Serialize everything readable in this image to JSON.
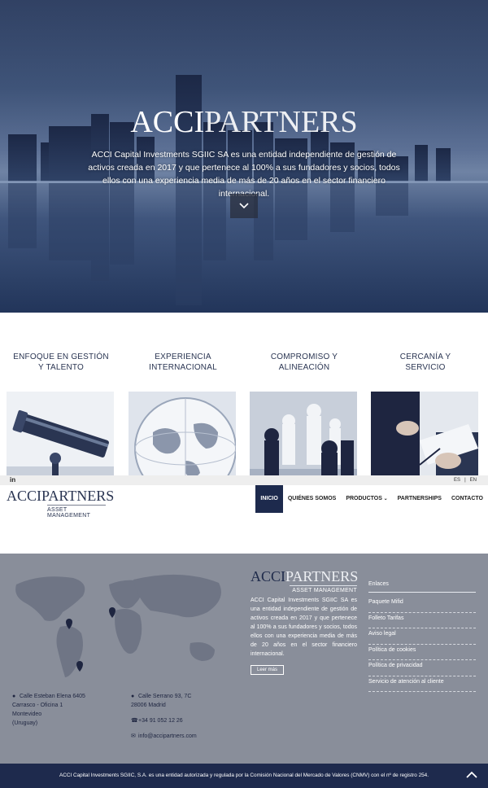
{
  "hero": {
    "logo_bold": "ACCI",
    "logo_light": "PARTNERS",
    "description": "ACCI Capital Investments SGIIC SA es una entidad independiente de gestión de activos creada en 2017 y que pertenece al 100% a sus fundadores y socios, todos ellos con una experiencia media de más de 20 años en el sector financiero internacional.",
    "scroll_icon": "chevron-down-icon"
  },
  "features": [
    {
      "title_line1": "ENFOQUE EN GESTIÓN",
      "title_line2": "Y TALENTO",
      "image": "telescope-image"
    },
    {
      "title_line1": "EXPERIENCIA",
      "title_line2": "INTERNACIONAL",
      "image": "globe-image"
    },
    {
      "title_line1": "COMPROMISO Y",
      "title_line2": "ALINEACIÓN",
      "image": "chess-image"
    },
    {
      "title_line1": "CERCANÍA Y",
      "title_line2": "SERVICIO",
      "image": "handshake-image"
    }
  ],
  "topbar": {
    "linkedin": "in",
    "lang_es": "ES",
    "lang_sep": "|",
    "lang_en": "EN"
  },
  "nav": {
    "logo_bold": "ACCI",
    "logo_light": "PARTNERS",
    "logo_sub": "ASSET MANAGEMENT",
    "items": [
      {
        "label": "INICIO"
      },
      {
        "label": "QUIÉNES SOMOS"
      },
      {
        "label": "PRODUCTOS"
      },
      {
        "label": "PARTNERSHIPS"
      },
      {
        "label": "CONTACTO"
      }
    ]
  },
  "footer": {
    "address1": {
      "line1": "Calle Esteban Elena 6405",
      "line2": "Carrasco - Oficina 1",
      "line3": "Montevideo",
      "line4": "(Uruguay)"
    },
    "address2": {
      "line1": "Calle Serrano 93, 7C",
      "line2": "28006 Madrid"
    },
    "phone": "+34 91 052 12 26",
    "email": "info@accipartners.com",
    "logo_bold": "ACCI",
    "logo_light": "PARTNERS",
    "logo_sub": "ASSET MANAGEMENT",
    "description": "ACCI Capital Investments SGIIC SA es una entidad independiente de gestión de activos creada en 2017 y que pertenece al 100% a sus fundadores y socios, todos ellos con una experiencia media de más de 20 años en el sector financiero internacional.",
    "read_more": "Leer más",
    "links_title": "Enlaces",
    "links": [
      {
        "label": "Paquete Mifid"
      },
      {
        "label": "Folleto Tarifas"
      },
      {
        "label": "Aviso legal"
      },
      {
        "label": "Política de cookies"
      },
      {
        "label": "Política de privacidad"
      },
      {
        "label": "Servicio de atención al cliente"
      }
    ]
  },
  "bottom": {
    "legal": "ACCI Capital Investments SGIIC, S.A. es una entidad autorizada y regulada por la Comisión Nacional del Mercado de Valores (CNMV) con el nº de registro 254."
  },
  "colors": {
    "navy": "#1e2a4d",
    "footer_gray": "#898e9a"
  }
}
